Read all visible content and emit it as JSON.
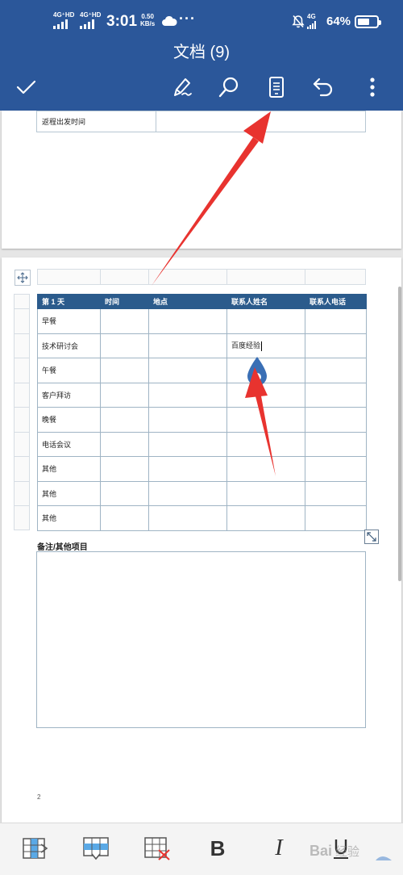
{
  "status_bar": {
    "network1": "4G⁺HD",
    "network2": "4G⁺HD",
    "time": "3:01",
    "speed_value": "0.50",
    "speed_unit": "KB/s",
    "more": "···",
    "network3": "4G",
    "battery": "64%",
    "battery_level": 0.64
  },
  "header": {
    "title": "文档 (9)",
    "icons": [
      "check-icon",
      "pen-icon",
      "search-icon",
      "mobile-view-icon",
      "undo-icon",
      "more-vert-icon"
    ]
  },
  "page1": {
    "table_row": {
      "label": "返程出发时间",
      "value": ""
    }
  },
  "page2": {
    "schedule_table": {
      "headers": [
        "第 1 天",
        "时间",
        "地点",
        "联系人姓名",
        "联系人电话"
      ],
      "rows": [
        [
          "早餐",
          "",
          "",
          "",
          ""
        ],
        [
          "技术研讨会",
          "",
          "",
          "百度经验",
          ""
        ],
        [
          "午餐",
          "",
          "",
          "",
          ""
        ],
        [
          "客户拜访",
          "",
          "",
          "",
          ""
        ],
        [
          "晚餐",
          "",
          "",
          "",
          ""
        ],
        [
          "电话会议",
          "",
          "",
          "",
          ""
        ],
        [
          "其他",
          "",
          "",
          "",
          ""
        ],
        [
          "其他",
          "",
          "",
          "",
          ""
        ],
        [
          "其他",
          "",
          "",
          "",
          ""
        ]
      ]
    },
    "notes_label": "备注/其他项目",
    "page_number": "2"
  },
  "bottom_bar": {
    "bold_label": "B",
    "italic_label": "I",
    "icons": [
      "insert-column-icon",
      "insert-row-icon",
      "delete-table-icon",
      "bold-icon",
      "italic-icon",
      "underline-icon"
    ]
  },
  "watermark": "Bai 经验",
  "colors": {
    "app_bar": "#2b579a",
    "table_header": "#2b5b8c",
    "annotation_arrow": "#e8332f",
    "selection_handle": "#3a6fb5"
  }
}
